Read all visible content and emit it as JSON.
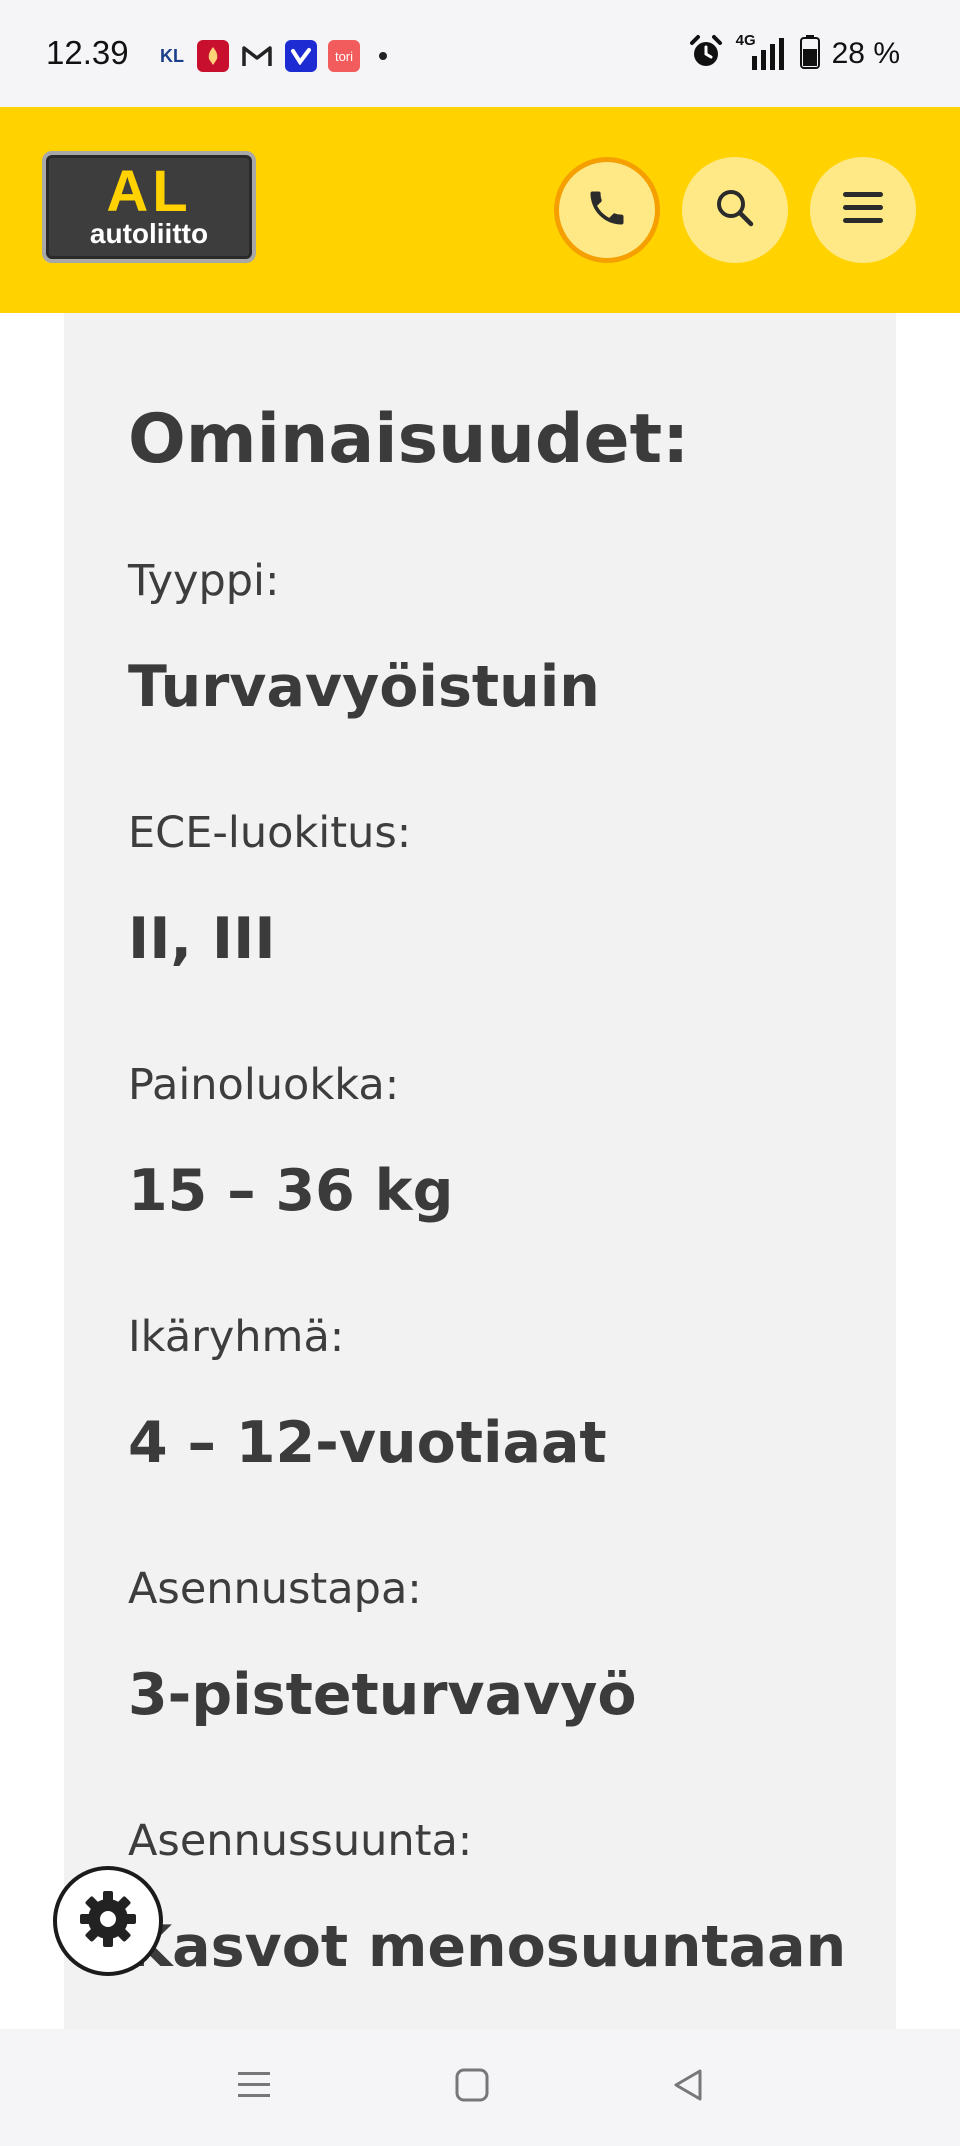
{
  "status_bar": {
    "time": "12.39",
    "notification_icons": [
      "kl-icon",
      "liverpool-icon",
      "gmail-icon",
      "v-app-icon",
      "tori-icon",
      "more-dot-icon"
    ],
    "kl_text": "KL",
    "tori_text": "tori",
    "network": "4G",
    "battery": "28 %"
  },
  "header": {
    "logo_main": "AL",
    "logo_sub": "autoliitto",
    "buttons": [
      "phone-icon",
      "search-icon",
      "menu-icon"
    ],
    "colors": {
      "background": "#ffd200",
      "button": "#ffe987",
      "phone_ring": "#f5a000"
    }
  },
  "features": {
    "title": "Ominaisuudet:",
    "items": [
      {
        "label": "Tyyppi:",
        "value": "Turvavyöistuin"
      },
      {
        "label": "ECE-luokitus:",
        "value": "II, III"
      },
      {
        "label": "Painoluokka:",
        "value": "15 – 36 kg"
      },
      {
        "label": "Ikäryhmä:",
        "value": "4 – 12-vuotiaat"
      },
      {
        "label": "Asennustapa:",
        "value": "3-pisteturvavyö"
      },
      {
        "label": "Asennussuunta:",
        "value": "Kasvot menosuuntaan"
      }
    ]
  },
  "floating": {
    "settings_icon": "gear-icon"
  },
  "nav_bar": {
    "buttons": [
      "recent-apps-icon",
      "home-icon",
      "back-icon"
    ]
  }
}
